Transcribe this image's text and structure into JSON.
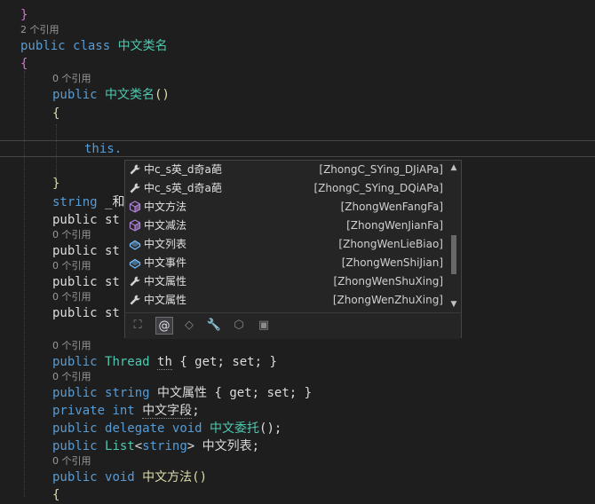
{
  "editor": {
    "close_brace_top": "}",
    "lens_refs_2": "2 个引用",
    "class_line": {
      "kw1": "public",
      "kw2": "class",
      "name": "中文类名"
    },
    "open_brace_class": "{",
    "lens_refs_0_ctor": "0 个引用",
    "ctor_line": {
      "kw": "public",
      "name": "中文类名",
      "parens": "()"
    },
    "ctor_open_brace": "{",
    "this_line": "this.",
    "ctor_close_brace": "}",
    "field_line": {
      "kw": "string",
      "partial": "_和"
    },
    "partial_public_st": "public st",
    "lens_0_a": "0 个引用",
    "lens_0_b": "0 个引用",
    "lens_0_c": "0 个引用",
    "lens_0_d": "0 个引用",
    "thread_line": {
      "kw": "public",
      "ty": "Thread",
      "name": "th",
      "body": "{ get; set; }"
    },
    "lens_0_e": "0 个引用",
    "prop_line": {
      "kw": "public",
      "ty": "string",
      "name": "中文属性",
      "body": "{ get; set; }"
    },
    "private_line": {
      "kw1": "private",
      "kw2": "int",
      "name": "中文字段",
      "semi": ";"
    },
    "delegate_line": {
      "kw1": "public",
      "kw2": "delegate",
      "kw3": "void",
      "name": "中文委托",
      "tail": "();"
    },
    "list_line": {
      "kw": "public",
      "ty": "List",
      "lt": "<",
      "inner": "string",
      "gt": ">",
      "name": "中文列表",
      "semi": ";"
    },
    "lens_0_f": "0 个引用",
    "method_line": {
      "kw1": "public",
      "kw2": "void",
      "name": "中文方法",
      "parens": "()"
    },
    "last_brace": "{"
  },
  "completion": {
    "items": [
      {
        "name": "中c_s英_d奇a葩",
        "abbr": "[ZhongC_SYing_DJiAPa]",
        "icon": "wrench-icon"
      },
      {
        "name": "中c_s英_d奇a葩",
        "abbr": "[ZhongC_SYing_DQiAPa]",
        "icon": "wrench-icon"
      },
      {
        "name": "中文方法",
        "abbr": "[ZhongWenFangFa]",
        "icon": "method-cube-icon"
      },
      {
        "name": "中文减法",
        "abbr": "[ZhongWenJianFa]",
        "icon": "method-cube-icon"
      },
      {
        "name": "中文列表",
        "abbr": "[ZhongWenLieBiao]",
        "icon": "field-icon"
      },
      {
        "name": "中文事件",
        "abbr": "[ZhongWenShiJian]",
        "icon": "field-icon"
      },
      {
        "name": "中文属性",
        "abbr": "[ZhongWenShuXing]",
        "icon": "wrench-icon"
      },
      {
        "name": "中文属性",
        "abbr": "[ZhongWenZhuXing]",
        "icon": "wrench-icon"
      }
    ],
    "filters": [
      {
        "icon": "expand-icon",
        "glyph": "⛶"
      },
      {
        "icon": "at-icon",
        "glyph": "@"
      },
      {
        "icon": "field-filter-icon",
        "glyph": "◇"
      },
      {
        "icon": "wrench-filter-icon",
        "glyph": "🔧"
      },
      {
        "icon": "cube-filter-icon",
        "glyph": "⬡"
      },
      {
        "icon": "class-filter-icon",
        "glyph": "▣"
      }
    ],
    "colors": {
      "method": "#b180d7",
      "field": "#75beff",
      "wrench": "#d4d4d4"
    }
  }
}
